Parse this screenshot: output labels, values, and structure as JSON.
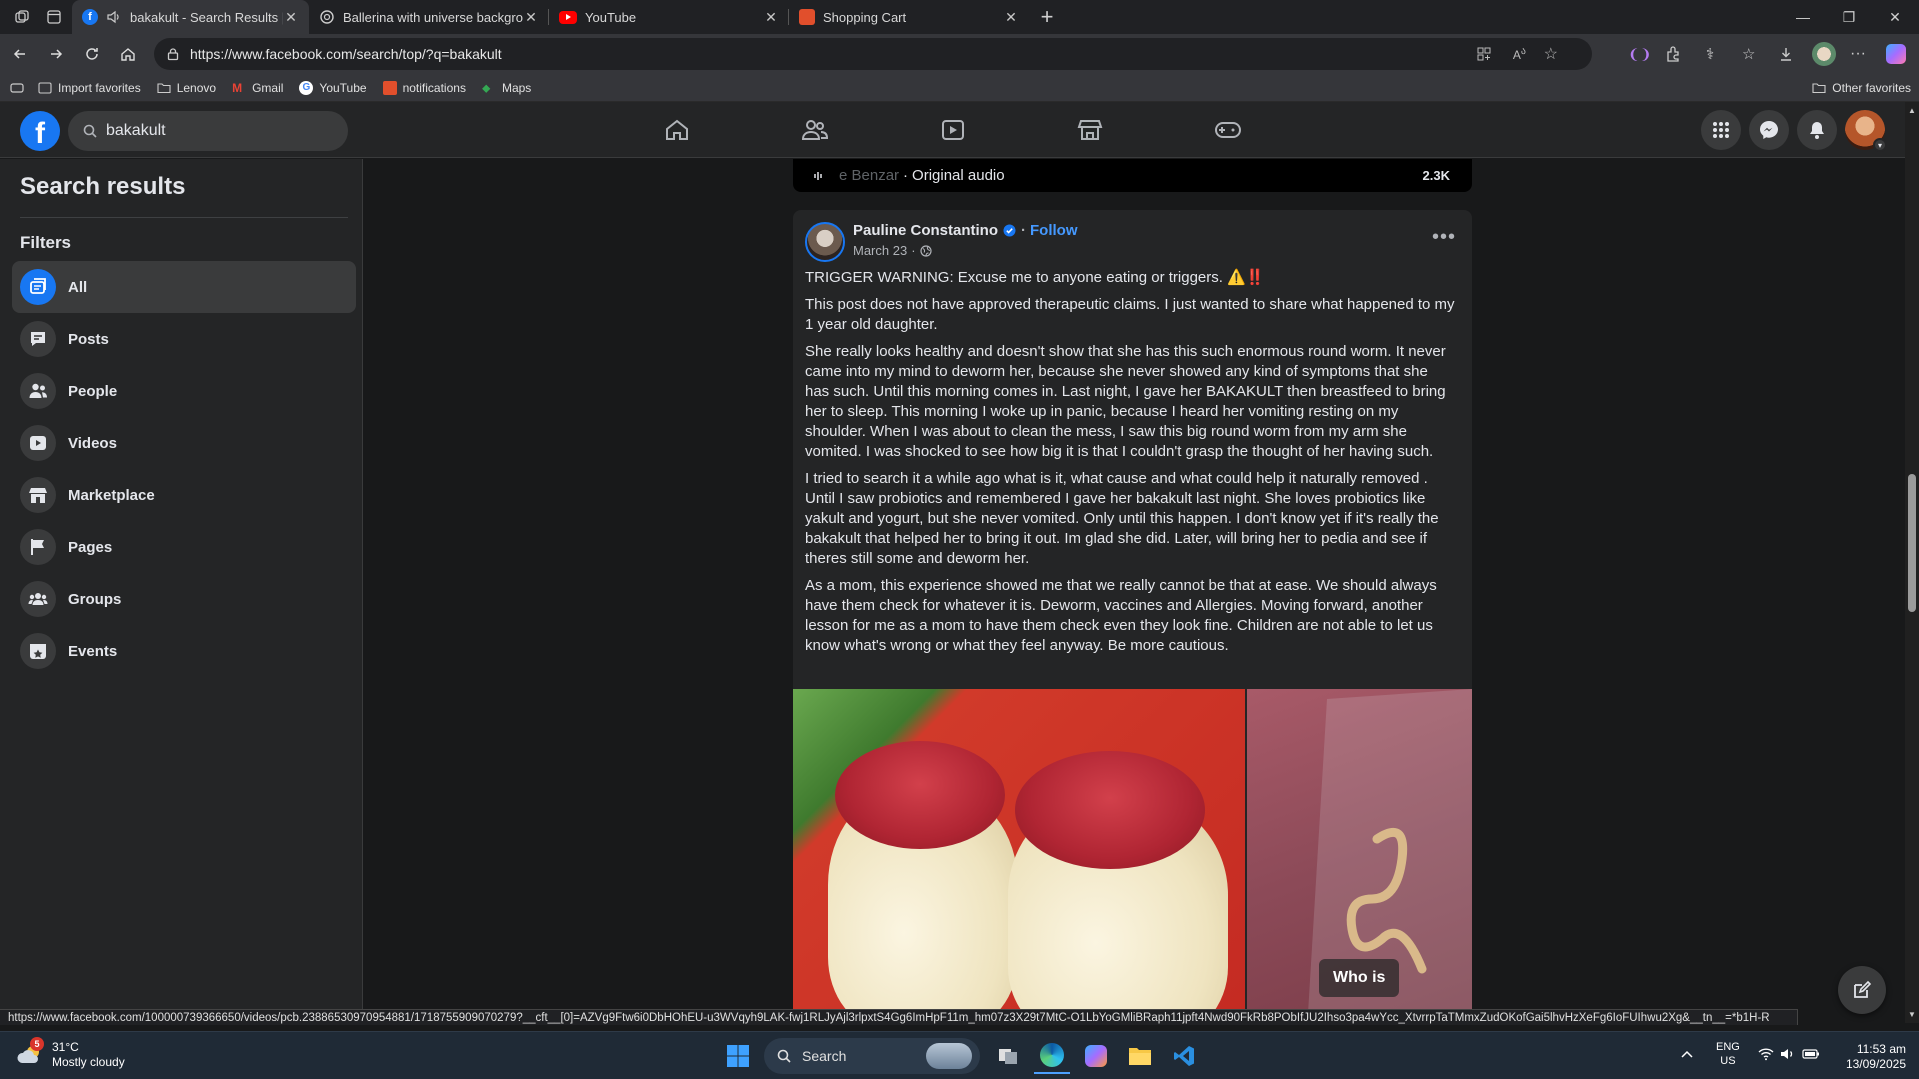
{
  "browser": {
    "tabs": [
      {
        "label": "bakakult - Search Results | Fa",
        "color": "#1877f2"
      },
      {
        "label": "Ballerina with universe backgroun",
        "color": "#cccccc"
      },
      {
        "label": "YouTube",
        "color": "#ff0000"
      },
      {
        "label": "Shopping Cart",
        "color": "#e14f2c"
      }
    ],
    "url": "https://www.facebook.com/search/top/?q=bakakult",
    "bookmarks": [
      {
        "label": "Import favorites"
      },
      {
        "label": "Lenovo"
      },
      {
        "label": "Gmail"
      },
      {
        "label": "YouTube"
      },
      {
        "label": "notifications"
      },
      {
        "label": "Maps"
      }
    ],
    "other_favorites": "Other favorites",
    "status_url": "https://www.facebook.com/100000739366650/videos/pcb.23886530970954881/1718755909070279?__cft__[0]=AZVg9Ftw6i0DbHOhEU-u3WVqyh9LAK-fwj1RLJyAjl3rlpxtS4Gg6ImHpF11m_hm07z3X29t7MtC-O1LbYoGMliBRaph11jpft4Nwd90FkRb8PObIfJU2Ihso3pa4wYcc_XtvrrpTaTMmxZudOKofGai5lhvHzXeFg6IoFUIhwu2Xg&__tn__=*b1H-R"
  },
  "facebook": {
    "search_value": "bakakult",
    "sidebar": {
      "title": "Search results",
      "filters_heading": "Filters",
      "filters": [
        {
          "label": "All",
          "icon": "all-results-icon",
          "active": true
        },
        {
          "label": "Posts",
          "icon": "posts-icon",
          "active": false
        },
        {
          "label": "People",
          "icon": "people-icon",
          "active": false
        },
        {
          "label": "Videos",
          "icon": "videos-icon",
          "active": false
        },
        {
          "label": "Marketplace",
          "icon": "marketplace-icon",
          "active": false
        },
        {
          "label": "Pages",
          "icon": "pages-flag-icon",
          "active": false
        },
        {
          "label": "Groups",
          "icon": "groups-icon",
          "active": false
        },
        {
          "label": "Events",
          "icon": "events-icon",
          "active": false
        }
      ]
    },
    "audio": {
      "artist_fragment": "e Benzar",
      "label": "Original audio",
      "count": "2.3K"
    },
    "post": {
      "author": "Pauline Constantino",
      "follow": "Follow",
      "date": "March 23",
      "paragraphs": [
        "TRIGGER WARNING: Excuse me to anyone eating or triggers. ⚠️‼️",
        "This post does not have approved therapeutic claims. I just wanted to share what happened to my 1 year old daughter.",
        "She really looks healthy and doesn't show that she has this such enormous round worm. It never came into my mind to deworm her, because she never showed any kind of symptoms that she has such. Until this morning comes in. Last night, I gave her BAKAKULT then breastfeed to bring her to sleep. This morning I woke up in panic, because I heard her vomiting resting on my shoulder. When I was about to clean the mess, I saw this big round worm from my arm she vomited. I was shocked to see how big it is that I couldn't grasp the thought  of her having such.",
        "I tried to search it a while ago what is it, what cause and what could help it naturally removed  . Until I saw probiotics and remembered I gave her bakakult last night. She loves probiotics like yakult and yogurt, but she never vomited. Only until this happen. I don't know yet if it's really the bakakult that helped her to bring it out. Im glad she did. Later, will bring her to pedia and see if theres still some and deworm her.",
        "As a mom, this experience showed me that we really cannot be that at ease. We should always have them check for whatever it is. Deworm, vaccines and Allergies. Moving forward, another lesson for me as a mom to have them check even they look fine. Children are not able to let us know what's wrong or what they feel anyway. Be more cautious."
      ],
      "photo_overlay": "Who is"
    }
  },
  "taskbar": {
    "weather_badge": "5",
    "temperature": "31°C",
    "condition": "Mostly cloudy",
    "search": "Search",
    "lang_top": "ENG",
    "lang_bottom": "US",
    "time": "11:53 am",
    "date": "13/09/2025"
  },
  "colors": {
    "fb_blue": "#1877f2",
    "link_blue": "#4599ff",
    "surface": "#242526",
    "background": "#18191a"
  }
}
